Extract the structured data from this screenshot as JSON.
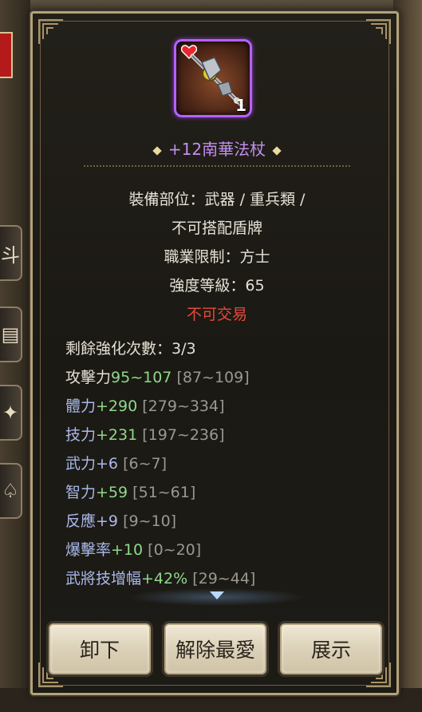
{
  "item": {
    "name": "+12南華法杖",
    "count": "1",
    "icon": "staff-weapon-icon",
    "rarity_color": "#b660ff"
  },
  "info": {
    "slot_line1": "裝備部位：武器 / 重兵類 /",
    "slot_line2": "不可搭配盾牌",
    "job_restriction": "職業限制：方士",
    "strength_level": "強度等級：65",
    "trade_status": "不可交易"
  },
  "stats": [
    {
      "label": "剩餘強化次數：3/3",
      "value": "",
      "range": ""
    },
    {
      "label": "攻擊力",
      "value": "95~107",
      "range": "[87~109]"
    },
    {
      "label": "體力",
      "value": "+290",
      "range": "[279~334]"
    },
    {
      "label": "技力",
      "value": "+231",
      "range": "[197~236]"
    },
    {
      "label": "武力",
      "value": "+6",
      "range": "[6~7]"
    },
    {
      "label": "智力",
      "value": "+59",
      "range": "[51~61]"
    },
    {
      "label": "反應",
      "value": "+9",
      "range": "[9~10]"
    },
    {
      "label": "爆擊率",
      "value": "+10",
      "range": "[0~20]"
    },
    {
      "label": "武將技增幅",
      "value": "+42%",
      "range": "[29~44]"
    }
  ],
  "buttons": {
    "unequip": "卸下",
    "unfavorite": "解除最愛",
    "show": "展示"
  },
  "colors": {
    "panel_border": "#b5a27a",
    "stat_green": "#8fd88a",
    "stat_blue_label": "#aab9ea",
    "warning_red": "#e34a3c"
  },
  "background": {
    "left_buttons": [
      "斗",
      "▤",
      "✦",
      "♤"
    ]
  }
}
